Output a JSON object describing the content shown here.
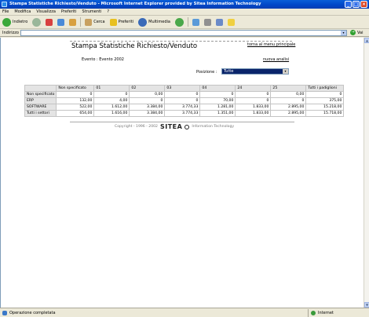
{
  "window": {
    "title": "Stampa Statistiche Richiesto/Venduto - Microsoft Internet Explorer provided by Sitea Information Technology"
  },
  "menu": [
    "File",
    "Modifica",
    "Visualizza",
    "Preferiti",
    "Strumenti",
    "?"
  ],
  "toolbar": {
    "back_label": "Indietro",
    "search_label": "Cerca",
    "favorites_label": "Preferiti",
    "multimedia_label": "Multimedia"
  },
  "address": {
    "label": "Indirizzo",
    "value": "",
    "go_label": "Vai"
  },
  "page": {
    "title": "Stampa Statistiche Richiesto/Venduto",
    "back_link": "torna al menu principale",
    "event": "Evento : Evento 2002",
    "new_analysis": "nuova analisi",
    "position_label": "Posizione :",
    "position_value": "Tutte"
  },
  "table": {
    "headers": [
      "",
      "Non specificato",
      "01",
      "02",
      "03",
      "04",
      "24",
      "25",
      "Tutti i padiglioni"
    ],
    "rows": [
      [
        "Non specificato",
        "0",
        "0",
        "0,00",
        "0",
        "0",
        "0",
        "0,00",
        "0"
      ],
      [
        "ERP",
        "132,00",
        "",
        "4,00",
        "0",
        "0",
        "70,00",
        "0",
        "0",
        "375,00"
      ],
      [
        "SOFTWARE",
        "522,00",
        "1.612,00",
        "3.384,00",
        "3.774,33",
        "1.281,00",
        "1.833,00",
        "2.895,00",
        "15.218,00"
      ],
      [
        "Tutti i settori",
        "654,00",
        "1.616,00",
        "3.384,00",
        "3.774,33",
        "1.351,00",
        "1.833,00",
        "2.895,00",
        "15.718,00"
      ]
    ]
  },
  "footer": {
    "copyright": "Copyright - 1996 - 2002",
    "logo": "SITEA",
    "tagline": "Information Technology"
  },
  "status": {
    "left": "Operazione completata",
    "zone": "Internet"
  }
}
